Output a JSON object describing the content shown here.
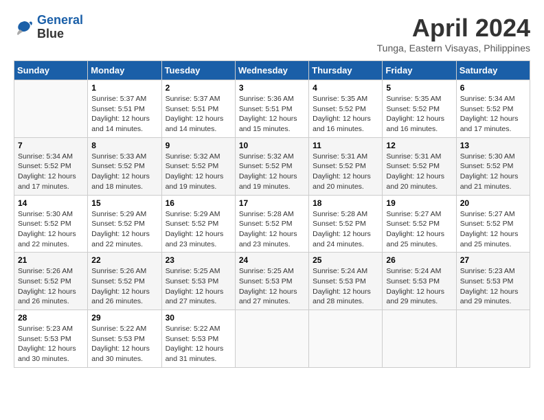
{
  "header": {
    "logo_line1": "General",
    "logo_line2": "Blue",
    "title": "April 2024",
    "subtitle": "Tunga, Eastern Visayas, Philippines"
  },
  "days_of_week": [
    "Sunday",
    "Monday",
    "Tuesday",
    "Wednesday",
    "Thursday",
    "Friday",
    "Saturday"
  ],
  "weeks": [
    [
      {
        "day": "",
        "info": ""
      },
      {
        "day": "1",
        "info": "Sunrise: 5:37 AM\nSunset: 5:51 PM\nDaylight: 12 hours\nand 14 minutes."
      },
      {
        "day": "2",
        "info": "Sunrise: 5:37 AM\nSunset: 5:51 PM\nDaylight: 12 hours\nand 14 minutes."
      },
      {
        "day": "3",
        "info": "Sunrise: 5:36 AM\nSunset: 5:51 PM\nDaylight: 12 hours\nand 15 minutes."
      },
      {
        "day": "4",
        "info": "Sunrise: 5:35 AM\nSunset: 5:52 PM\nDaylight: 12 hours\nand 16 minutes."
      },
      {
        "day": "5",
        "info": "Sunrise: 5:35 AM\nSunset: 5:52 PM\nDaylight: 12 hours\nand 16 minutes."
      },
      {
        "day": "6",
        "info": "Sunrise: 5:34 AM\nSunset: 5:52 PM\nDaylight: 12 hours\nand 17 minutes."
      }
    ],
    [
      {
        "day": "7",
        "info": "Sunrise: 5:34 AM\nSunset: 5:52 PM\nDaylight: 12 hours\nand 17 minutes."
      },
      {
        "day": "8",
        "info": "Sunrise: 5:33 AM\nSunset: 5:52 PM\nDaylight: 12 hours\nand 18 minutes."
      },
      {
        "day": "9",
        "info": "Sunrise: 5:32 AM\nSunset: 5:52 PM\nDaylight: 12 hours\nand 19 minutes."
      },
      {
        "day": "10",
        "info": "Sunrise: 5:32 AM\nSunset: 5:52 PM\nDaylight: 12 hours\nand 19 minutes."
      },
      {
        "day": "11",
        "info": "Sunrise: 5:31 AM\nSunset: 5:52 PM\nDaylight: 12 hours\nand 20 minutes."
      },
      {
        "day": "12",
        "info": "Sunrise: 5:31 AM\nSunset: 5:52 PM\nDaylight: 12 hours\nand 20 minutes."
      },
      {
        "day": "13",
        "info": "Sunrise: 5:30 AM\nSunset: 5:52 PM\nDaylight: 12 hours\nand 21 minutes."
      }
    ],
    [
      {
        "day": "14",
        "info": "Sunrise: 5:30 AM\nSunset: 5:52 PM\nDaylight: 12 hours\nand 22 minutes."
      },
      {
        "day": "15",
        "info": "Sunrise: 5:29 AM\nSunset: 5:52 PM\nDaylight: 12 hours\nand 22 minutes."
      },
      {
        "day": "16",
        "info": "Sunrise: 5:29 AM\nSunset: 5:52 PM\nDaylight: 12 hours\nand 23 minutes."
      },
      {
        "day": "17",
        "info": "Sunrise: 5:28 AM\nSunset: 5:52 PM\nDaylight: 12 hours\nand 23 minutes."
      },
      {
        "day": "18",
        "info": "Sunrise: 5:28 AM\nSunset: 5:52 PM\nDaylight: 12 hours\nand 24 minutes."
      },
      {
        "day": "19",
        "info": "Sunrise: 5:27 AM\nSunset: 5:52 PM\nDaylight: 12 hours\nand 25 minutes."
      },
      {
        "day": "20",
        "info": "Sunrise: 5:27 AM\nSunset: 5:52 PM\nDaylight: 12 hours\nand 25 minutes."
      }
    ],
    [
      {
        "day": "21",
        "info": "Sunrise: 5:26 AM\nSunset: 5:52 PM\nDaylight: 12 hours\nand 26 minutes."
      },
      {
        "day": "22",
        "info": "Sunrise: 5:26 AM\nSunset: 5:52 PM\nDaylight: 12 hours\nand 26 minutes."
      },
      {
        "day": "23",
        "info": "Sunrise: 5:25 AM\nSunset: 5:53 PM\nDaylight: 12 hours\nand 27 minutes."
      },
      {
        "day": "24",
        "info": "Sunrise: 5:25 AM\nSunset: 5:53 PM\nDaylight: 12 hours\nand 27 minutes."
      },
      {
        "day": "25",
        "info": "Sunrise: 5:24 AM\nSunset: 5:53 PM\nDaylight: 12 hours\nand 28 minutes."
      },
      {
        "day": "26",
        "info": "Sunrise: 5:24 AM\nSunset: 5:53 PM\nDaylight: 12 hours\nand 29 minutes."
      },
      {
        "day": "27",
        "info": "Sunrise: 5:23 AM\nSunset: 5:53 PM\nDaylight: 12 hours\nand 29 minutes."
      }
    ],
    [
      {
        "day": "28",
        "info": "Sunrise: 5:23 AM\nSunset: 5:53 PM\nDaylight: 12 hours\nand 30 minutes."
      },
      {
        "day": "29",
        "info": "Sunrise: 5:22 AM\nSunset: 5:53 PM\nDaylight: 12 hours\nand 30 minutes."
      },
      {
        "day": "30",
        "info": "Sunrise: 5:22 AM\nSunset: 5:53 PM\nDaylight: 12 hours\nand 31 minutes."
      },
      {
        "day": "",
        "info": ""
      },
      {
        "day": "",
        "info": ""
      },
      {
        "day": "",
        "info": ""
      },
      {
        "day": "",
        "info": ""
      }
    ]
  ]
}
